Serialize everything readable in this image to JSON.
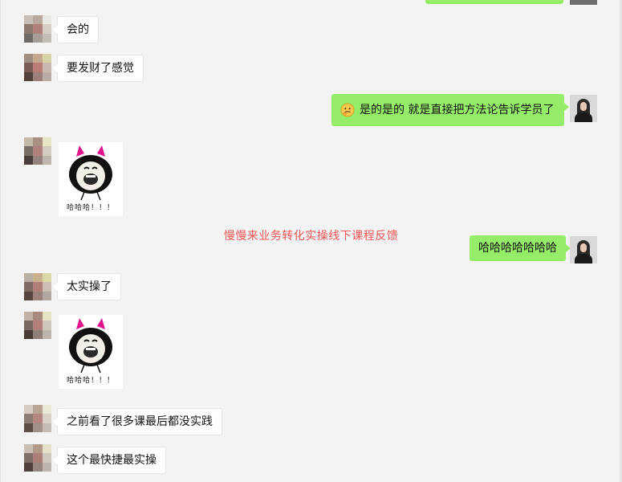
{
  "messages": [
    {
      "id": "m1",
      "side": "left",
      "type": "text",
      "text": "会的"
    },
    {
      "id": "m2",
      "side": "left",
      "type": "text",
      "text": "要发财了感觉"
    },
    {
      "id": "m3",
      "side": "right",
      "type": "text",
      "emoji": "thinking-face-emoji",
      "text": "是的是的  就是直接把方法论告诉学员了"
    },
    {
      "id": "m4",
      "side": "left",
      "type": "sticker",
      "caption": "哈哈哈！！！"
    },
    {
      "id": "m5",
      "side": "right",
      "type": "text",
      "text": "哈哈哈哈哈哈哈"
    },
    {
      "id": "m6",
      "side": "left",
      "type": "text",
      "text": "太实操了"
    },
    {
      "id": "m7",
      "side": "left",
      "type": "sticker",
      "caption": "哈哈哈！！！"
    },
    {
      "id": "m8",
      "side": "left",
      "type": "text",
      "text": "之前看了很多课最后都没实践"
    },
    {
      "id": "m9",
      "side": "left",
      "type": "text",
      "text": "这个最快捷最实操"
    }
  ],
  "watermark": "慢慢来业务转化实操线下课程反馈",
  "colors": {
    "background": "#f3f3f3",
    "right_bubble": "#95ec69",
    "left_bubble": "#ffffff",
    "watermark": "#f05656"
  }
}
